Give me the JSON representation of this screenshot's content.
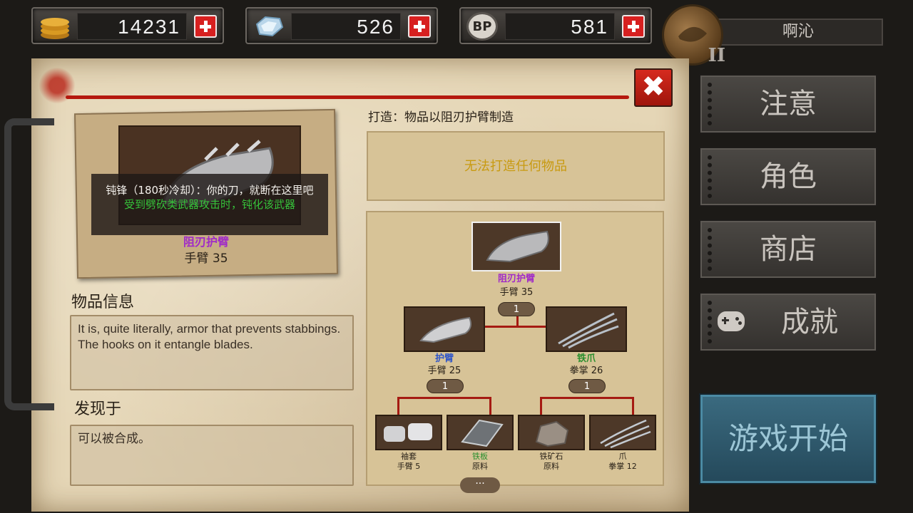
{
  "currency": {
    "gold": "14231",
    "diamonds": "526",
    "bp": "581",
    "bp_icon_text": "BP"
  },
  "player": {
    "name": "啊沁",
    "rank": "II"
  },
  "item": {
    "tooltip_line1": "钝锋（180秒冷却）：你的刀，就断在这里吧",
    "tooltip_line2": "受到劈砍类武器攻击时，钝化该武器",
    "name": "阻刃护臂",
    "stat": "手臂 35"
  },
  "info": {
    "title": "物品信息",
    "description": "It is, quite literally, armor that prevents stabbings. The hooks on it entangle blades."
  },
  "found": {
    "title": "发现于",
    "text": "可以被合成。"
  },
  "craft": {
    "title": "打造：物品以阻刃护臂制造",
    "message": "无法打造任何物品",
    "root": {
      "name": "阻刃护臂",
      "stat": "手臂 35",
      "qty": "1"
    },
    "level2": [
      {
        "name": "护臂",
        "stat": "手臂 25",
        "qty": "1",
        "color": "#2f55c8"
      },
      {
        "name": "铁爪",
        "stat": "拳掌 26",
        "qty": "1",
        "color": "#2a8f2e"
      }
    ],
    "level3": [
      {
        "name": "袖套",
        "stat": "手臂 5",
        "color": "#2a2218"
      },
      {
        "name": "铁板",
        "stat": "原料",
        "color": "#2a8f2e"
      },
      {
        "name": "铁矿石",
        "stat": "原料",
        "color": "#2a2218"
      },
      {
        "name": "爪",
        "stat": "拳掌 12",
        "color": "#2a2218"
      }
    ],
    "more": "···"
  },
  "menu": {
    "notice": "注意",
    "character": "角色",
    "shop": "商店",
    "achievement": "成就",
    "start": "游戏开始"
  },
  "colors": {
    "accent_red": "#b5180e",
    "legendary_purple": "#a02ac8",
    "uncommon_green": "#36c23a",
    "craft_msg_yellow": "#c89a10",
    "start_button_blue": "#3b6b80"
  }
}
